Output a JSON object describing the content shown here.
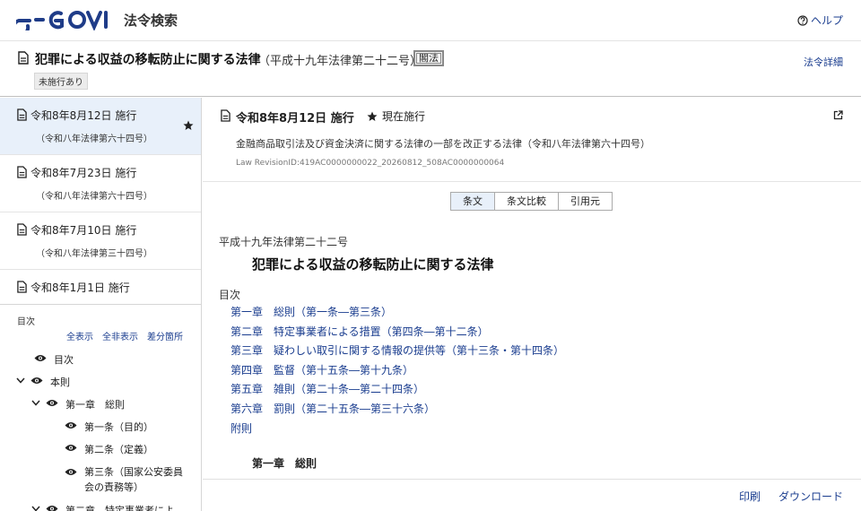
{
  "header": {
    "site_name": "法令検索",
    "help_label": "ヘルプ"
  },
  "law": {
    "title": "犯罪による収益の移転防止に関する法律",
    "number": "（平成十九年法律第二十二号）",
    "kakuho_label": "閣法",
    "detail_link": "法令詳細",
    "status_badge": "未施行あり"
  },
  "revisions": [
    {
      "date": "令和8年8月12日 施行",
      "num": "（令和八年法律第六十四号）",
      "starred": true
    },
    {
      "date": "令和8年7月23日 施行",
      "num": "（令和八年法律第六十四号）",
      "starred": false
    },
    {
      "date": "令和8年7月10日 施行",
      "num": "（令和八年法律第三十四号）",
      "starred": false
    },
    {
      "date": "令和8年1月1日 施行",
      "num": "",
      "starred": false
    }
  ],
  "toc_panel": {
    "heading": "目次",
    "links": [
      "全表示",
      "全非表示",
      "差分箇所"
    ],
    "rows": [
      {
        "label": "目次",
        "chevron": ""
      },
      {
        "label": "本則",
        "chevron": "down"
      },
      {
        "label": "第一章　総則",
        "chevron": "down"
      },
      {
        "label": "第一条（目的）",
        "chevron": ""
      },
      {
        "label": "第二条（定義）",
        "chevron": ""
      },
      {
        "label": "第三条（国家公安委員会の責務等）",
        "chevron": ""
      },
      {
        "label": "第二章　特定事業者によ",
        "chevron": "down"
      }
    ]
  },
  "revision_head": {
    "date": "令和8年8月12日 施行",
    "current_label": "現在施行",
    "amend_law": "金融商品取引法及び資金決済に関する法律の一部を改正する法律（令和八年法律第六十四号）",
    "revision_id": "Law RevisionID:419AC0000000022_20260812_508AC0000000064"
  },
  "tabs": [
    "条文",
    "条文比較",
    "引用元"
  ],
  "body": {
    "law_number": "平成十九年法律第二十二号",
    "title": "犯罪による収益の移転防止に関する法律",
    "toc_label": "目次",
    "chapters": [
      "第一章　総則（第一条―第三条）",
      "第二章　特定事業者による措置（第四条―第十二条）",
      "第三章　疑わしい取引に関する情報の提供等（第十三条・第十四条）",
      "第四章　監督（第十五条―第十九条）",
      "第五章　雑則（第二十条―第二十四条）",
      "第六章　罰則（第二十五条―第三十六条）",
      "附則"
    ],
    "chapter1_heading": "第一章　総則"
  },
  "footer": {
    "print_label": "印刷",
    "download_label": "ダウンロード"
  },
  "colors": {
    "link": "#1a3d8f",
    "logo": "#1f3c88",
    "active_bg": "#e8f0fa"
  },
  "icons": [
    "egov-logo",
    "help-icon",
    "document-icon",
    "star-icon",
    "external-link-icon",
    "eye-icon",
    "chevron-down-icon"
  ]
}
